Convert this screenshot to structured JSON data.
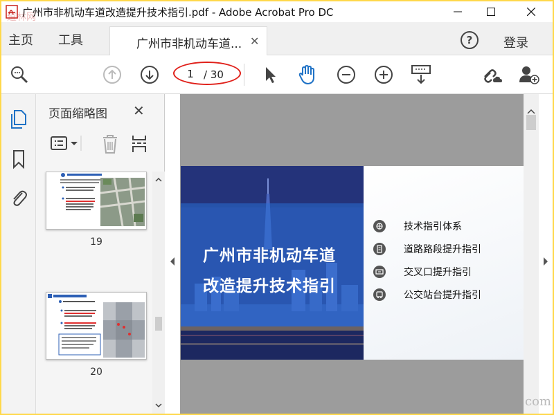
{
  "window": {
    "title": "广州市非机动车道改造提升技术指引.pdf - Adobe Acrobat Pro DC",
    "watermark_top": "道林网",
    "watermark_bottom": "com"
  },
  "tabs": {
    "home": "主页",
    "tools": "工具",
    "document": "广州市非机动车道...",
    "login": "登录"
  },
  "toolbar": {
    "current_page": "1",
    "total_pages": "/ 30"
  },
  "thumbnail_panel": {
    "title": "页面缩略图",
    "pages": [
      {
        "number": "19"
      },
      {
        "number": "20"
      }
    ]
  },
  "slide": {
    "title_line1": "广州市非机动车道",
    "title_line2": "改造提升技术指引",
    "items": [
      {
        "label": "技术指引体系",
        "icon": "compass-icon"
      },
      {
        "label": "道路路段提升指引",
        "icon": "document-icon"
      },
      {
        "label": "交叉口提升指引",
        "icon": "intersection-icon"
      },
      {
        "label": "公交站台提升指引",
        "icon": "bus-stop-icon"
      }
    ]
  },
  "colors": {
    "accent": "#1f72c6",
    "highlight_oval": "#e0201a",
    "slide_blue": "#3a56b4"
  }
}
